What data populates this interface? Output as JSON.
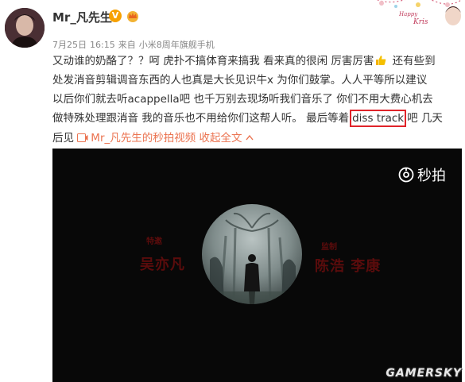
{
  "post": {
    "username": "Mr_凡先生",
    "verified_badge": "V",
    "meta": {
      "date": "7月25日",
      "time": "16:15",
      "source_prefix": "来自",
      "device": "小米8周年旗舰手机"
    },
    "lines": [
      {
        "a": "又动谁的奶酪了？？呵 虎扑不搞体育来搞我 看来真的很闲 厉害厉害",
        "b": " 还有些到"
      },
      {
        "a": "处发消音剪辑调音东西的人也真是大长见识牛x 为你们鼓掌。人人平等所以建议"
      },
      {
        "a": "以后你们就去听acappella吧 也千万别去现场听我们音乐了 你们不用大费心机去"
      },
      {
        "a": "做特殊处理跟消音 我的音乐也不用给你们这帮人听。 最后等着",
        "highlight": "diss track",
        "b": "吧 几天"
      },
      {
        "a": "后见 "
      }
    ],
    "video_link_text": "Mr_凡先生的秒拍视频",
    "collapse_text": "收起全文"
  },
  "video": {
    "logo_text": "秒拍",
    "credit_left_small": "特邀",
    "credit_left_big": "吴亦凡",
    "credit_right_small": "监制",
    "credit_right_big": "陈浩 李康"
  },
  "watermark": "GAMERSKY",
  "colors": {
    "link": "#eb7350",
    "highlight_box": "#e0242a",
    "verified": "#f7a100",
    "video_bg": "#080808"
  }
}
